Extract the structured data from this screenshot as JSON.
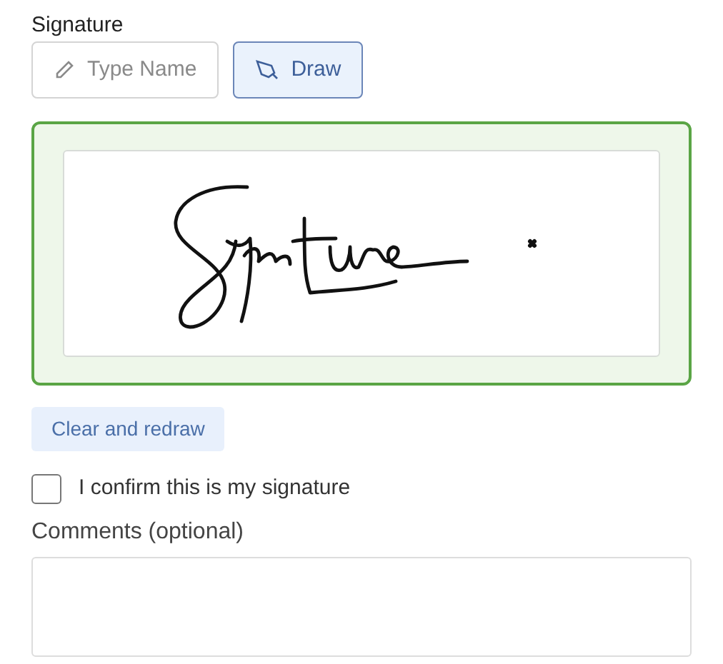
{
  "signature_label": "Signature",
  "modes": [
    {
      "label": "Type Name",
      "kind": "type",
      "selected": false
    },
    {
      "label": "Draw",
      "kind": "draw",
      "selected": true
    }
  ],
  "clear_button": "Clear and redraw",
  "confirm": {
    "label": "I confirm this is my signature",
    "checked": false
  },
  "comments": {
    "label": "Comments (optional)"
  }
}
